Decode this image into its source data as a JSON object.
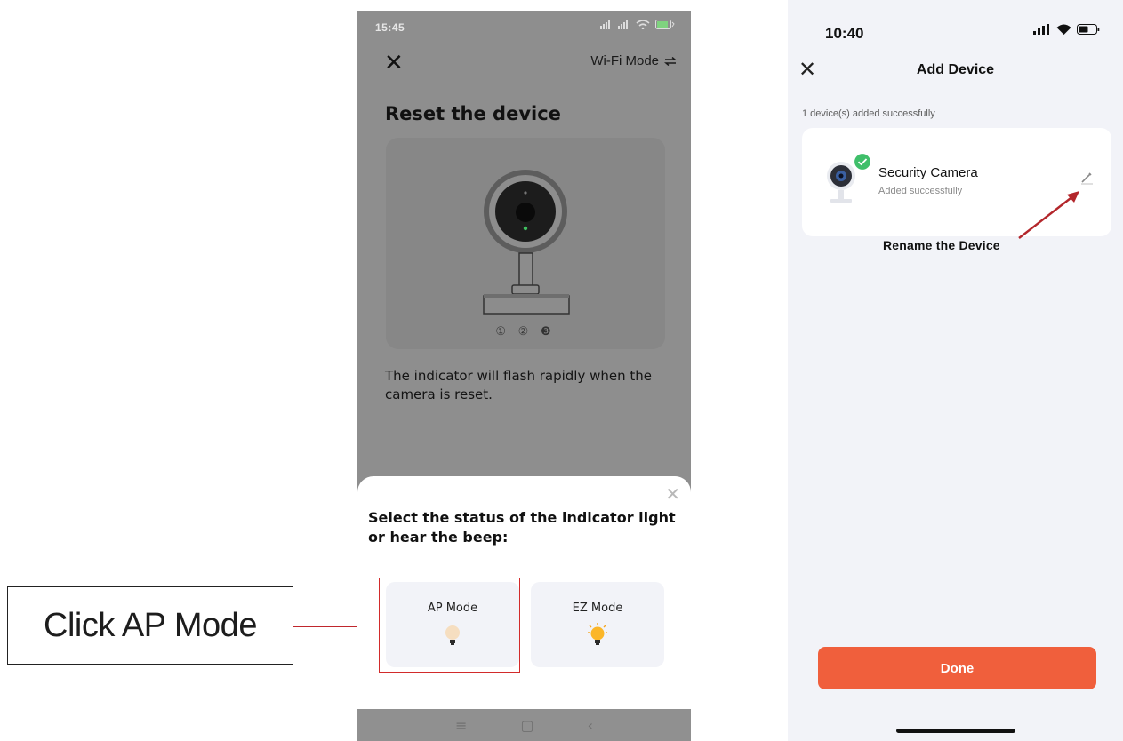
{
  "callout": {
    "text": "Click AP Mode",
    "line_color": "#c0272d"
  },
  "phone1": {
    "status": {
      "time": "15:45"
    },
    "header": {
      "close_icon": "close-icon",
      "mode_label": "Wi-Fi Mode",
      "mode_icon": "switch-arrows-icon"
    },
    "title": "Reset the device",
    "steps": "① ② ❸",
    "description": "The indicator will flash rapidly when the camera is reset.",
    "sheet": {
      "title": "Select the status of the indicator light or hear the beep:",
      "options": [
        {
          "label": "AP Mode",
          "icon": "bulb-off-icon",
          "selected_highlight": true
        },
        {
          "label": "EZ Mode",
          "icon": "bulb-on-icon"
        }
      ]
    },
    "nav": {
      "menu": "≡",
      "home": "▢",
      "back": "‹"
    }
  },
  "phone2": {
    "status": {
      "time": "10:40"
    },
    "header": {
      "title": "Add Device"
    },
    "added_text": "1 device(s) added successfully",
    "device": {
      "name": "Security Camera",
      "status": "Added successfully",
      "icon": "camera-icon"
    },
    "annotation": "Rename the Device",
    "done_label": "Done",
    "accent_color": "#f05f3c"
  }
}
